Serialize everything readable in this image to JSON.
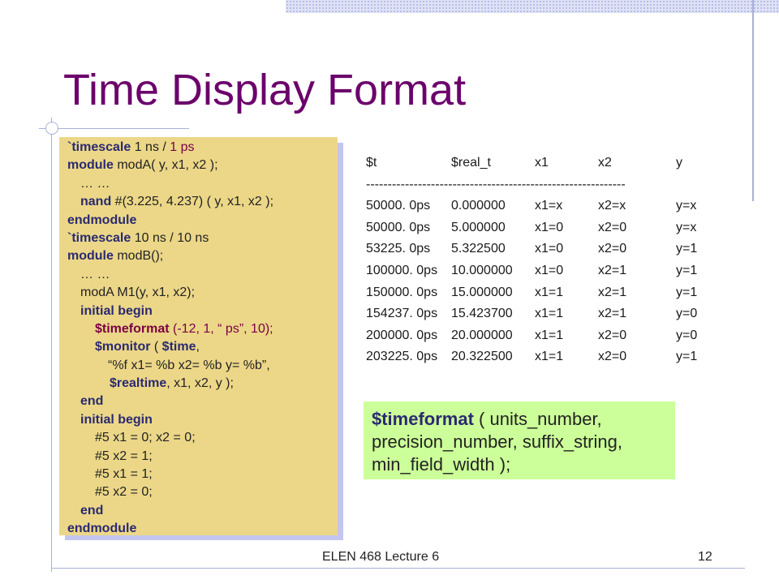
{
  "slide": {
    "title": "Time Display Format",
    "footer": "ELEN 468 Lecture 6",
    "page_number": "12"
  },
  "code": {
    "l1": {
      "a": "`timescale",
      "b": " 1 ns / ",
      "c": "1 ps"
    },
    "l2": {
      "a": "module",
      "b": " modA( y, x1, x2 );"
    },
    "l3": {
      "a": "… …"
    },
    "l4": {
      "a": "nand",
      "b": " #(3.225, 4.237) ( y, x1, x2 );"
    },
    "l5": {
      "a": "endmodule"
    },
    "l6": {
      "a": "`timescale",
      "b": " 10 ns / 10 ns"
    },
    "l7": {
      "a": "module",
      "b": " modB();"
    },
    "l8": {
      "a": "… …"
    },
    "l9": {
      "a": "modA M1(y, x1, x2);"
    },
    "l10": {
      "a": "initial begin"
    },
    "l11": {
      "a": "$timeformat",
      "b": " (-12, 1, “ ps”, 10);"
    },
    "l12": {
      "a": "$monitor",
      "b": " ( ",
      "c": "$time",
      "d": ","
    },
    "l13": {
      "a": "“%f x1= %b x2= %b y= %b”,"
    },
    "l14": {
      "a": "$realtime",
      "b": ", x1, x2, y );"
    },
    "l15": {
      "a": "end"
    },
    "l16": {
      "a": "initial begin"
    },
    "l17": {
      "a": "#5 x1 = 0; x2 = 0;"
    },
    "l18": {
      "a": "#5 x2 = 1;"
    },
    "l19": {
      "a": "#5 x1 = 1;"
    },
    "l20": {
      "a": "#5 x2 = 0;"
    },
    "l21": {
      "a": "end"
    },
    "l22": {
      "a": "endmodule"
    }
  },
  "output": {
    "headers": [
      "$t",
      "$real_t",
      "x1",
      "x2",
      "y"
    ],
    "divider": "------------------------------------------------------------",
    "rows": [
      [
        "50000. 0ps",
        "0.000000",
        "x1=x",
        "x2=x",
        "y=x"
      ],
      [
        "50000. 0ps",
        "5.000000",
        "x1=0",
        "x2=0",
        "y=x"
      ],
      [
        "53225. 0ps",
        "5.322500",
        "x1=0",
        "x2=0",
        "y=1"
      ],
      [
        "100000. 0ps",
        "10.000000",
        "x1=0",
        "x2=1",
        "y=1"
      ],
      [
        "150000. 0ps",
        "15.000000",
        "x1=1",
        "x2=1",
        "y=1"
      ],
      [
        "154237. 0ps",
        "15.423700",
        "x1=1",
        "x2=1",
        "y=0"
      ],
      [
        "200000. 0ps",
        "20.000000",
        "x1=1",
        "x2=0",
        "y=0"
      ],
      [
        "203225. 0ps",
        "20.322500",
        "x1=1",
        "x2=0",
        "y=1"
      ]
    ]
  },
  "syntax": {
    "keyword": "$timeformat",
    "rest": " ( units_number, precision_number, suffix_string, min_field_width );"
  },
  "colors": {
    "title": "#6b006b",
    "code_background": "#ecd788",
    "syntax_background": "#ccff99"
  }
}
